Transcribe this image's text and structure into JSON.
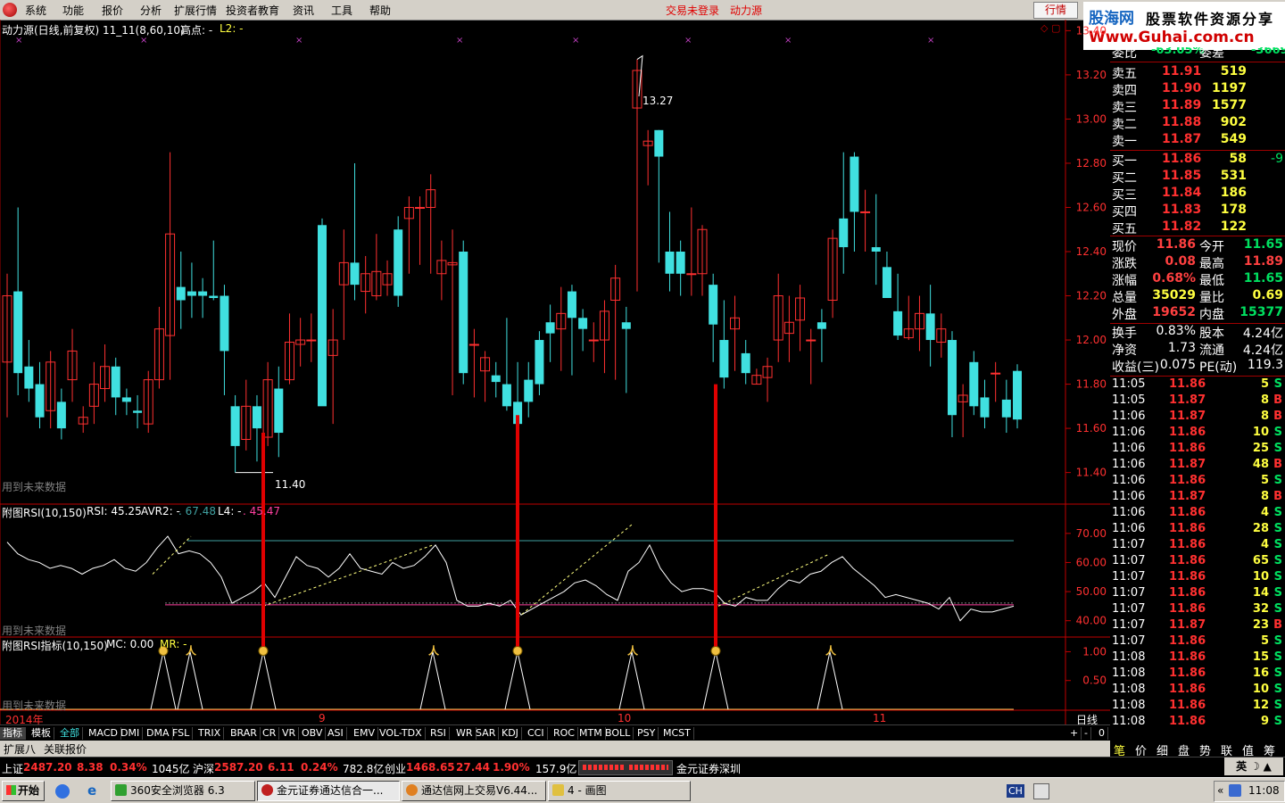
{
  "menu": [
    "系统",
    "功能",
    "报价",
    "分析",
    "扩展行情",
    "投资者教育",
    "资讯",
    "工具",
    "帮助"
  ],
  "status": {
    "login": "交易未登录",
    "source": "动力源",
    "hangqing": "行情"
  },
  "logo": {
    "cn": "股海网",
    "tag": "股票软件资源分享",
    "url": "Www.Guhai.com.cn"
  },
  "main_title": {
    "name": "动力源(日线,前复权) 11_11(8,60,10)",
    "high_label": "高点: -",
    "l2_label": "L2: -"
  },
  "main_note": "用到未来数据",
  "high_label_val": "13.27",
  "low_label_val": "11.40",
  "rsi_title": {
    "name": "附图RSI(10,150)",
    "rsi": "RSI: 45.25",
    "avr2": "AVR2: -",
    "avr2_val": ". 67.48",
    "l4": "L4: -",
    "l4_val": ". 45.47"
  },
  "rsi_note": "用到未来数据",
  "sig_title": {
    "name": "附图RSI指标(10,150)",
    "mc": "MC: 0.00",
    "mr": "MR: -"
  },
  "sig_note": "用到未来数据",
  "date_axis": [
    "2014年",
    "9",
    "10",
    "11"
  ],
  "period_label": "日线",
  "chart_data": [
    {
      "type": "candlestick",
      "title": "动力源(日线,前复权)",
      "price_axis_ticks": [
        "13.40",
        "13.20",
        "13.00",
        "12.80",
        "12.60",
        "12.40",
        "12.20",
        "12.00",
        "11.80",
        "11.60",
        "11.40"
      ],
      "ylim": [
        11.35,
        13.45
      ],
      "candles": [
        [
          11.9,
          12.2,
          12.3,
          11.65
        ],
        [
          12.22,
          11.85,
          12.6,
          11.75
        ],
        [
          11.88,
          11.78,
          12.0,
          11.72
        ],
        [
          11.8,
          11.65,
          11.9,
          11.6
        ],
        [
          11.68,
          11.9,
          11.95,
          11.6
        ],
        [
          11.72,
          11.6,
          11.78,
          11.55
        ],
        [
          11.82,
          11.95,
          12.05,
          11.72
        ],
        [
          11.62,
          11.65,
          11.7,
          11.58
        ],
        [
          11.7,
          11.8,
          11.9,
          11.62
        ],
        [
          11.78,
          11.88,
          11.98,
          11.72
        ],
        [
          11.88,
          11.74,
          11.92,
          11.66
        ],
        [
          11.74,
          11.72,
          11.78,
          11.66
        ],
        [
          11.68,
          11.67,
          11.75,
          11.6
        ],
        [
          11.62,
          11.82,
          11.86,
          11.58
        ],
        [
          11.82,
          12.05,
          12.15,
          11.78
        ],
        [
          12.02,
          12.48,
          12.85,
          11.82
        ],
        [
          12.24,
          12.18,
          12.4,
          12.05
        ],
        [
          12.22,
          12.2,
          12.35,
          12.1
        ],
        [
          12.22,
          12.2,
          12.28,
          12.1
        ],
        [
          12.2,
          12.19,
          12.45,
          12.18
        ],
        [
          12.2,
          11.95,
          12.25,
          11.75
        ],
        [
          11.7,
          11.52,
          11.75,
          11.4
        ],
        [
          11.55,
          11.7,
          11.82,
          11.5
        ],
        [
          11.7,
          11.6,
          11.75,
          11.45
        ],
        [
          11.56,
          11.82,
          11.9,
          11.52
        ],
        [
          11.78,
          11.58,
          11.88,
          11.47
        ],
        [
          11.82,
          11.99,
          12.12,
          11.8
        ],
        [
          11.98,
          12.0,
          12.1,
          11.88
        ],
        [
          12.0,
          12.0,
          12.12,
          11.9
        ],
        [
          12.52,
          11.7,
          12.55,
          11.85
        ],
        [
          11.93,
          12.0,
          12.14,
          11.62
        ],
        [
          12.25,
          12.35,
          12.5,
          12.0
        ],
        [
          12.35,
          12.25,
          12.8,
          12.18
        ],
        [
          12.22,
          12.3,
          12.38,
          12.12
        ],
        [
          12.2,
          12.31,
          12.48,
          12.18
        ],
        [
          12.25,
          12.3,
          12.36,
          12.2
        ],
        [
          12.5,
          12.2,
          12.56,
          12.15
        ],
        [
          12.55,
          12.6,
          12.65,
          12.3
        ],
        [
          12.6,
          12.6,
          12.65,
          12.34
        ],
        [
          12.6,
          12.68,
          12.75,
          12.3
        ],
        [
          12.3,
          12.36,
          12.45,
          12.18
        ],
        [
          12.34,
          12.35,
          12.5,
          11.75
        ],
        [
          12.4,
          11.85,
          12.45,
          11.8
        ],
        [
          11.98,
          11.98,
          12.05,
          11.74
        ],
        [
          11.86,
          11.92,
          11.95,
          11.72
        ],
        [
          11.84,
          11.81,
          11.9,
          11.74
        ],
        [
          11.8,
          11.7,
          12.1,
          11.68
        ],
        [
          11.72,
          11.62,
          11.9,
          11.6
        ],
        [
          11.82,
          11.72,
          11.9,
          11.65
        ],
        [
          12.0,
          11.8,
          12.04,
          11.75
        ],
        [
          12.08,
          12.03,
          12.16,
          11.9
        ],
        [
          12.05,
          12.12,
          12.24,
          11.86
        ],
        [
          12.22,
          12.1,
          12.25,
          11.84
        ],
        [
          12.1,
          12.05,
          12.14,
          11.95
        ],
        [
          12.0,
          12.0,
          12.08,
          11.9
        ],
        [
          12.0,
          12.13,
          12.18,
          11.85
        ],
        [
          12.18,
          12.28,
          12.34,
          11.82
        ],
        [
          12.08,
          12.05,
          12.15,
          11.76
        ],
        [
          13.05,
          13.22,
          13.27,
          12.22
        ],
        [
          12.88,
          12.9,
          12.95,
          12.7
        ],
        [
          12.95,
          12.83,
          12.95,
          12.35
        ],
        [
          12.4,
          12.3,
          12.58,
          12.22
        ],
        [
          12.4,
          12.3,
          12.45,
          12.2
        ],
        [
          12.3,
          12.3,
          12.6,
          12.2
        ],
        [
          12.3,
          12.5,
          12.52,
          12.2
        ],
        [
          12.25,
          12.07,
          12.3,
          11.9
        ],
        [
          12.0,
          11.83,
          12.18,
          11.78
        ],
        [
          12.05,
          12.1,
          12.2,
          11.86
        ],
        [
          11.94,
          11.85,
          12.0,
          11.8
        ],
        [
          11.8,
          11.84,
          11.87,
          11.8
        ],
        [
          11.83,
          11.88,
          11.92,
          11.72
        ],
        [
          12.0,
          12.2,
          12.3,
          11.9
        ],
        [
          12.03,
          12.08,
          12.2,
          11.9
        ],
        [
          12.09,
          12.19,
          12.25,
          11.95
        ],
        [
          12.0,
          12.0,
          12.05,
          11.8
        ],
        [
          12.08,
          12.05,
          12.14,
          11.9
        ],
        [
          12.18,
          12.46,
          12.5,
          12.1
        ],
        [
          12.55,
          12.42,
          12.85,
          12.3
        ],
        [
          12.83,
          12.58,
          12.85,
          12.4
        ],
        [
          12.58,
          12.58,
          12.68,
          12.4
        ],
        [
          12.42,
          12.4,
          12.66,
          12.25
        ],
        [
          12.33,
          12.19,
          12.4,
          12.22
        ],
        [
          12.13,
          12.02,
          12.3,
          12.0
        ],
        [
          12.01,
          12.05,
          12.2,
          12.0
        ],
        [
          12.05,
          12.12,
          12.2,
          11.95
        ],
        [
          12.12,
          12.0,
          12.25,
          11.88
        ],
        [
          11.99,
          12.05,
          12.12,
          11.92
        ],
        [
          12.0,
          11.66,
          12.04,
          11.56
        ],
        [
          11.72,
          11.75,
          11.8,
          11.56
        ],
        [
          11.9,
          11.7,
          11.95,
          11.66
        ],
        [
          11.74,
          11.65,
          11.82,
          11.6
        ],
        [
          11.85,
          11.85,
          11.9,
          11.72
        ],
        [
          11.73,
          11.65,
          11.82,
          11.58
        ],
        [
          11.86,
          11.64,
          11.89,
          11.6
        ]
      ]
    },
    {
      "type": "line",
      "title": "附图RSI(10,150)",
      "ylim": [
        35,
        77
      ],
      "ytick_labels": [
        "70.00",
        "60.00",
        "50.00",
        "40.00"
      ],
      "series": [
        {
          "name": "RSI",
          "values": [
            67,
            63,
            61,
            60,
            58,
            59,
            58,
            56,
            58,
            59,
            61,
            58,
            57,
            60,
            65,
            69,
            63,
            64,
            63,
            60,
            55,
            46,
            48,
            50,
            53,
            48,
            55,
            62,
            59,
            58,
            55,
            58,
            63,
            58,
            57,
            56,
            60,
            58,
            59,
            62,
            66,
            60,
            47,
            45,
            45,
            46,
            45,
            47,
            42,
            44,
            46,
            48,
            50,
            53,
            54,
            52,
            49,
            47,
            57,
            60,
            66,
            58,
            53,
            50,
            51,
            51,
            50,
            46,
            45,
            48,
            47,
            47,
            51,
            54,
            53,
            56,
            57,
            60,
            62,
            58,
            55,
            52,
            48,
            49,
            48,
            47,
            46,
            44,
            48,
            40,
            44,
            43,
            43,
            44,
            45
          ]
        },
        {
          "name": "AVR2",
          "values": [
            67.48
          ]
        },
        {
          "name": "L4",
          "values": [
            45.47
          ]
        }
      ]
    },
    {
      "type": "line",
      "title": "附图RSI指标(10,150)",
      "ylim": [
        0,
        1.1
      ],
      "ytick_labels": [
        "1.00",
        "0.50"
      ],
      "series": [
        {
          "name": "MC",
          "values": [
            0.0
          ]
        }
      ]
    }
  ],
  "orderbook": {
    "header": {
      "label1": "委比",
      "val1": "-63.05%",
      "label2": "委差",
      "val2": "-3669"
    },
    "asks": [
      {
        "label": "卖五",
        "price": "11.91",
        "vol": "519"
      },
      {
        "label": "卖四",
        "price": "11.90",
        "vol": "1197"
      },
      {
        "label": "卖三",
        "price": "11.89",
        "vol": "1577"
      },
      {
        "label": "卖二",
        "price": "11.88",
        "vol": "902"
      },
      {
        "label": "卖一",
        "price": "11.87",
        "vol": "549"
      }
    ],
    "bids": [
      {
        "label": "买一",
        "price": "11.86",
        "vol": "58",
        "chg": "-9"
      },
      {
        "label": "买二",
        "price": "11.85",
        "vol": "531",
        "chg": ""
      },
      {
        "label": "买三",
        "price": "11.84",
        "vol": "186",
        "chg": ""
      },
      {
        "label": "买四",
        "price": "11.83",
        "vol": "178",
        "chg": ""
      },
      {
        "label": "买五",
        "price": "11.82",
        "vol": "122",
        "chg": ""
      }
    ],
    "stats": [
      {
        "l1": "现价",
        "v1": "11.86",
        "c1": "#ff4040",
        "l2": "今开",
        "v2": "11.65",
        "c2": "#00e060"
      },
      {
        "l1": "涨跌",
        "v1": "0.08",
        "c1": "#ff4040",
        "l2": "最高",
        "v2": "11.89",
        "c2": "#ff4040"
      },
      {
        "l1": "涨幅",
        "v1": "0.68%",
        "c1": "#ff4040",
        "l2": "最低",
        "v2": "11.65",
        "c2": "#00e060"
      },
      {
        "l1": "总量",
        "v1": "35029",
        "c1": "#ffff40",
        "l2": "量比",
        "v2": "0.69",
        "c2": "#ffff40"
      },
      {
        "l1": "外盘",
        "v1": "19652",
        "c1": "#ff4040",
        "l2": "内盘",
        "v2": "15377",
        "c2": "#00e060"
      }
    ],
    "stats2": [
      {
        "l1": "换手",
        "v1": "0.83%",
        "l2": "股本",
        "v2": "4.24亿"
      },
      {
        "l1": "净资",
        "v1": "1.73",
        "l2": "流通",
        "v2": "4.24亿"
      },
      {
        "l1": "收益(三)",
        "v1": "0.075",
        "l2": "PE(动)",
        "v2": "119.3"
      }
    ]
  },
  "ticks": [
    [
      "11:05",
      "11.86",
      "5",
      "S"
    ],
    [
      "11:05",
      "11.87",
      "8",
      "B"
    ],
    [
      "11:06",
      "11.87",
      "8",
      "B"
    ],
    [
      "11:06",
      "11.86",
      "10",
      "S"
    ],
    [
      "11:06",
      "11.86",
      "25",
      "S"
    ],
    [
      "11:06",
      "11.87",
      "48",
      "B"
    ],
    [
      "11:06",
      "11.86",
      "5",
      "S"
    ],
    [
      "11:06",
      "11.87",
      "8",
      "B"
    ],
    [
      "11:06",
      "11.86",
      "4",
      "S"
    ],
    [
      "11:06",
      "11.86",
      "28",
      "S"
    ],
    [
      "11:07",
      "11.86",
      "4",
      "S"
    ],
    [
      "11:07",
      "11.86",
      "65",
      "S"
    ],
    [
      "11:07",
      "11.86",
      "10",
      "S"
    ],
    [
      "11:07",
      "11.86",
      "14",
      "S"
    ],
    [
      "11:07",
      "11.86",
      "32",
      "S"
    ],
    [
      "11:07",
      "11.87",
      "23",
      "B"
    ],
    [
      "11:07",
      "11.86",
      "5",
      "S"
    ],
    [
      "11:08",
      "11.86",
      "15",
      "S"
    ],
    [
      "11:08",
      "11.86",
      "16",
      "S"
    ],
    [
      "11:08",
      "11.86",
      "10",
      "S"
    ],
    [
      "11:08",
      "11.86",
      "12",
      "S"
    ],
    [
      "11:08",
      "11.86",
      "9",
      "S"
    ]
  ],
  "indicator_tabs": [
    "指标",
    "模板",
    "全部",
    "MACD",
    "DMI",
    "DMA",
    "FSL",
    "TRIX",
    "BRAR",
    "CR",
    "VR",
    "OBV",
    "ASI",
    "EMV",
    "VOL-TDX",
    "RSI",
    "WR",
    "SAR",
    "KDJ",
    "CCI",
    "ROC",
    "MTM",
    "BOLL",
    "PSY",
    "MCST"
  ],
  "ind_controls": [
    "+",
    "-",
    "0"
  ],
  "ext_tabs": [
    "扩展八",
    "关联报价"
  ],
  "rp_tabs": [
    "笔",
    "价",
    "细",
    "盘",
    "势",
    "联",
    "值",
    "筹"
  ],
  "ticker": {
    "sh_label": "上证",
    "sh_val": "2487.20",
    "sh_chg": "8.38",
    "sh_pct": "0.34%",
    "sh_amt": "1045亿",
    "hs_label": "沪深",
    "hs_val": "2587.20",
    "hs_chg": "6.11",
    "hs_pct": "0.24%",
    "hs_amt": "782.8亿",
    "cy_label": "创业",
    "cy_val": "1468.65",
    "cy_chg": "27.44",
    "cy_pct": "1.90%",
    "cy_amt": "157.9亿",
    "broker": "金元证券深圳"
  },
  "taskbar": {
    "start": "开始",
    "items": [
      "360安全浏览器 6.3",
      "金元证券通达信合一...",
      "通达信网上交易V6.44...",
      "4 - 画图"
    ],
    "ime": "英",
    "lang": "CH",
    "time": "11:08"
  },
  "colors": {
    "up": "#ff3030",
    "down": "#40e0e0",
    "bg": "#000000",
    "grid_red": "#a00000",
    "axis_red": "#c00000"
  }
}
